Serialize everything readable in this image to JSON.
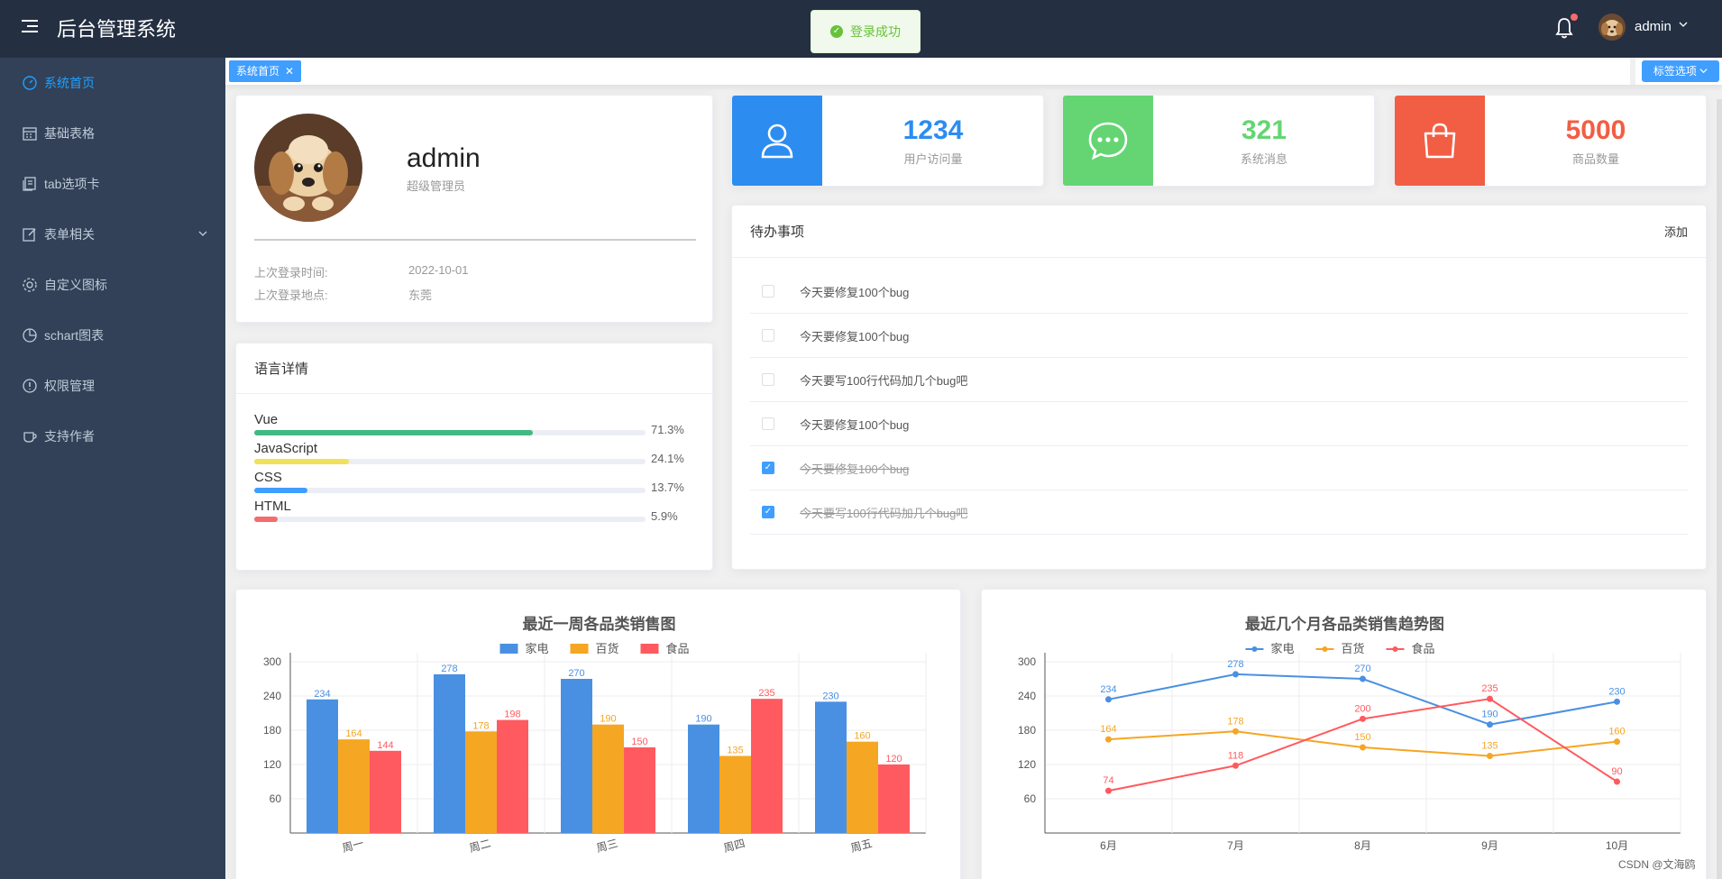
{
  "header": {
    "logo": "后台管理系统",
    "username": "admin",
    "toast": "登录成功"
  },
  "sidebar": {
    "items": [
      {
        "label": "系统首页",
        "icon": "odometer-icon",
        "active": true
      },
      {
        "label": "基础表格",
        "icon": "calendar-icon"
      },
      {
        "label": "tab选项卡",
        "icon": "document-copy-icon"
      },
      {
        "label": "表单相关",
        "icon": "edit-icon",
        "has_submenu": true
      },
      {
        "label": "自定义图标",
        "icon": "setting-icon"
      },
      {
        "label": "schart图表",
        "icon": "pie-chart-icon"
      },
      {
        "label": "权限管理",
        "icon": "warning-icon"
      },
      {
        "label": "支持作者",
        "icon": "coffee-cup-icon"
      }
    ]
  },
  "tabs": {
    "items": [
      {
        "label": "系统首页"
      }
    ],
    "options_label": "标签选项"
  },
  "profile": {
    "name": "admin",
    "role": "超级管理员",
    "last_login_time_label": "上次登录时间:",
    "last_login_time": "2022-10-01",
    "last_login_place_label": "上次登录地点:",
    "last_login_place": "东莞"
  },
  "languages": {
    "title": "语言详情",
    "items": [
      {
        "name": "Vue",
        "percent": 71.3,
        "percent_label": "71.3%",
        "color": "#42b983"
      },
      {
        "name": "JavaScript",
        "percent": 24.1,
        "percent_label": "24.1%",
        "color": "#f1e05a"
      },
      {
        "name": "CSS",
        "percent": 13.7,
        "percent_label": "13.7%",
        "color": "#409eff"
      },
      {
        "name": "HTML",
        "percent": 5.9,
        "percent_label": "5.9%",
        "color": "#f56c6c"
      }
    ]
  },
  "stats": [
    {
      "value": "1234",
      "label": "用户访问量",
      "color": "#2d8cf0",
      "icon": "user-icon"
    },
    {
      "value": "321",
      "label": "系统消息",
      "color": "#64d572",
      "icon": "chat-icon"
    },
    {
      "value": "5000",
      "label": "商品数量",
      "color": "#f25e43",
      "icon": "goods-icon"
    }
  ],
  "todo": {
    "title": "待办事项",
    "add_label": "添加",
    "items": [
      {
        "title": "今天要修复100个bug",
        "done": false
      },
      {
        "title": "今天要修复100个bug",
        "done": false
      },
      {
        "title": "今天要写100行代码加几个bug吧",
        "done": false
      },
      {
        "title": "今天要修复100个bug",
        "done": false
      },
      {
        "title": "今天要修复100个bug",
        "done": true
      },
      {
        "title": "今天要写100行代码加几个bug吧",
        "done": true
      }
    ]
  },
  "chart_data": [
    {
      "type": "bar",
      "title": "最近一周各品类销售图",
      "categories": [
        "周一",
        "周二",
        "周三",
        "周四",
        "周五"
      ],
      "series": [
        {
          "name": "家电",
          "values": [
            234,
            278,
            270,
            190,
            230
          ],
          "color": "#4a90e2"
        },
        {
          "name": "百货",
          "values": [
            164,
            178,
            190,
            135,
            160
          ],
          "color": "#f5a623"
        },
        {
          "name": "食品",
          "values": [
            144,
            198,
            150,
            235,
            120
          ],
          "color": "#ff5a5f"
        }
      ],
      "ylim": [
        0,
        300
      ],
      "yticks": [
        60,
        120,
        180,
        240,
        300
      ],
      "grid": true,
      "legend": "top-center"
    },
    {
      "type": "line",
      "title": "最近几个月各品类销售趋势图",
      "categories": [
        "6月",
        "7月",
        "8月",
        "9月",
        "10月"
      ],
      "series": [
        {
          "name": "家电",
          "values": [
            234,
            278,
            270,
            190,
            230
          ],
          "color": "#4a90e2"
        },
        {
          "name": "百货",
          "values": [
            164,
            178,
            150,
            135,
            160
          ],
          "color": "#f5a623"
        },
        {
          "name": "食品",
          "values": [
            74,
            118,
            200,
            235,
            90
          ],
          "color": "#ff5a5f"
        }
      ],
      "ylim": [
        0,
        300
      ],
      "yticks": [
        60,
        120,
        180,
        240,
        300
      ],
      "grid": true,
      "legend": "top-center"
    }
  ],
  "footer": {
    "watermark": "CSDN @文海鸥"
  }
}
